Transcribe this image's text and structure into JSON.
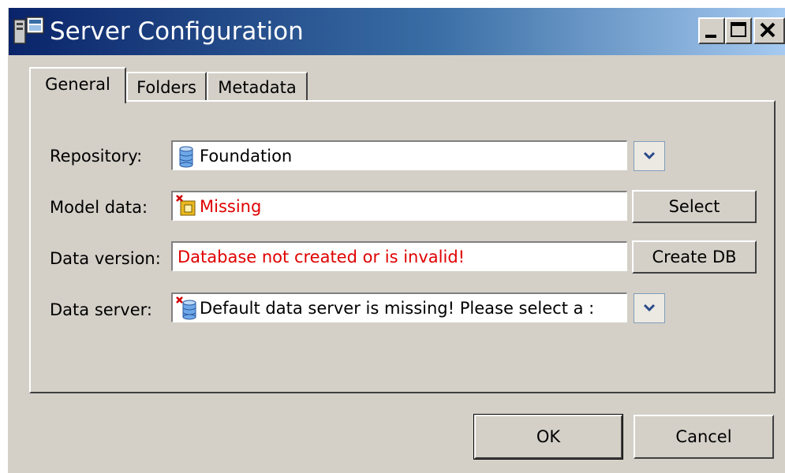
{
  "window": {
    "title": "Server Configuration",
    "icon": "server-config-icon",
    "controls": [
      "minimize-icon",
      "maximize-icon",
      "close-icon"
    ]
  },
  "tabs": [
    {
      "label": "General",
      "active": true
    },
    {
      "label": "Folders",
      "active": false
    },
    {
      "label": "Metadata",
      "active": false
    }
  ],
  "form": {
    "repository": {
      "label": "Repository:",
      "value": "Foundation",
      "icon": "database-icon"
    },
    "model_data": {
      "label": "Model data:",
      "value": "Missing",
      "icon": "package-error-icon",
      "button": "Select"
    },
    "data_version": {
      "label": "Data version:",
      "value": "Database not created or is invalid!",
      "button": "Create DB"
    },
    "data_server": {
      "label": "Data server:",
      "value": "Default data server is missing! Please select a :",
      "icon": "database-error-icon"
    }
  },
  "buttons": {
    "ok": "OK",
    "cancel": "Cancel"
  },
  "colors": {
    "error_text": "#e00000",
    "title_start": "#0a246a",
    "title_end": "#a6caf0",
    "face": "#d4d0c8"
  }
}
